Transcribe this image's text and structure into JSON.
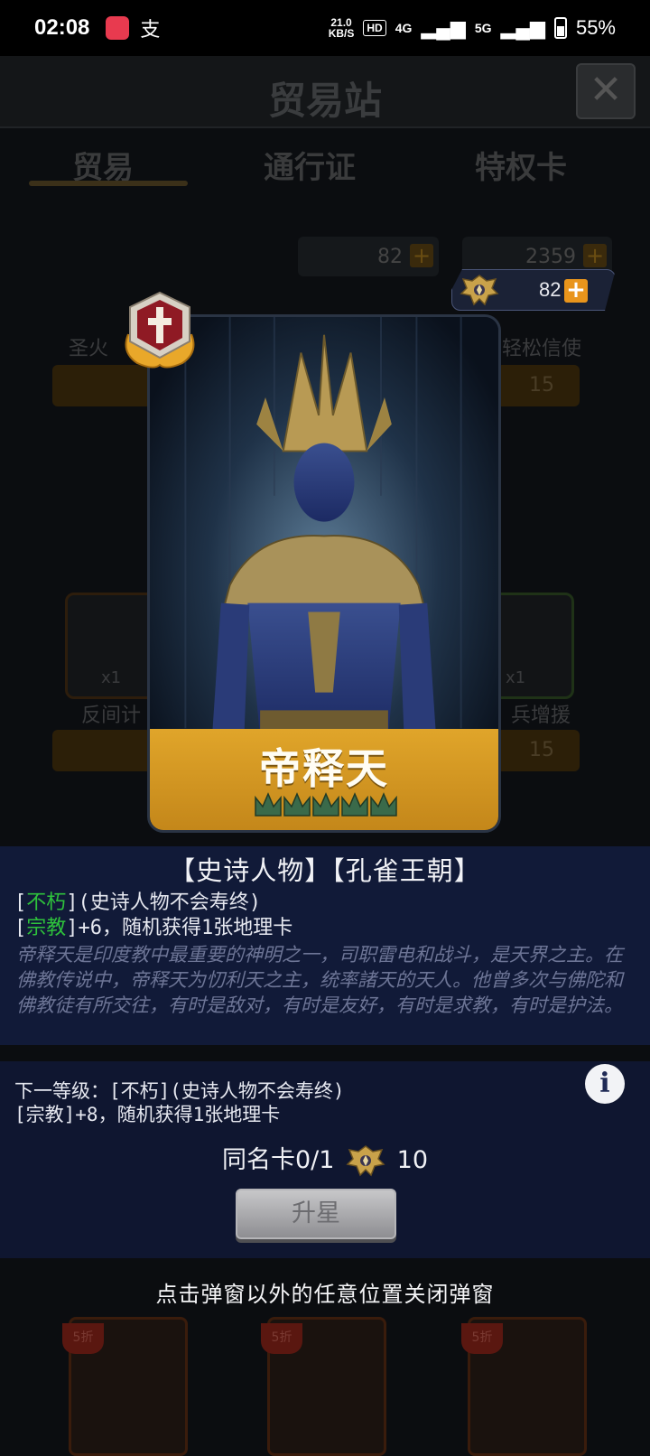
{
  "status_bar": {
    "time": "02:08",
    "net_speed_value": "21.0",
    "net_speed_unit": "KB/S",
    "hd_label": "HD",
    "signal1": "4G",
    "signal2": "5G",
    "battery": "55%"
  },
  "background": {
    "title": "贸易站",
    "tabs": [
      "贸易",
      "通行证",
      "特权卡"
    ],
    "currency_bg_1": "82",
    "currency_bg_2": "2359",
    "items": [
      "圣火",
      "轻松信使",
      "反间计",
      "兵增援"
    ],
    "item_count": "x1",
    "price_15": "15",
    "discount_label": "5折"
  },
  "currency_badge": {
    "value": "82",
    "plus_label": "+"
  },
  "card": {
    "name": "帝释天",
    "crown_count": 5
  },
  "info": {
    "tags": "【史诗人物】【孔雀王朝】",
    "trait1_bracket_open": "[",
    "trait1_name": "不朽",
    "trait1_text": "](史诗人物不会寿终)",
    "trait2_bracket_open": "[",
    "trait2_name": "宗教",
    "trait2_text": "]+6，随机获得1张地理卡",
    "description": "帝释天是印度教中最重要的神明之一，司职雷电和战斗，是天界之主。在佛教传说中，帝释天为忉利天之主，统率諸天的天人。他曾多次与佛陀和佛教徒有所交往，有时是敌对，有时是友好，有时是求教，有时是护法。"
  },
  "upgrade": {
    "next_level_line1": "下一等级：[不朽](史诗人物不会寿终)",
    "next_level_line2": "[宗教]+8，随机获得1张地理卡",
    "dup_label": "同名卡0/1",
    "dup_cost": "10",
    "star_button": "升星",
    "info_icon": "i"
  },
  "hint": "点击弹窗以外的任意位置关闭弹窗",
  "colors": {
    "accent_gold": "#e0a52a",
    "panel_blue": "#121b3a",
    "trait_green": "#2ec23c",
    "plus_orange": "#e9951c"
  }
}
